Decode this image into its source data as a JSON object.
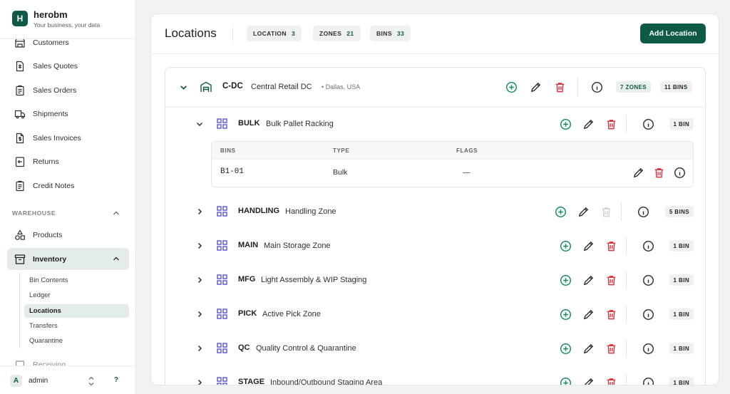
{
  "brand": {
    "logo_letter": "H",
    "name": "herobm",
    "tagline": "Your business, your data"
  },
  "sidebar": {
    "items": [
      {
        "label": "Customers",
        "icon": "storefront-icon"
      },
      {
        "label": "Sales Quotes",
        "icon": "quote-icon"
      },
      {
        "label": "Sales Orders",
        "icon": "clipboard-icon"
      },
      {
        "label": "Shipments",
        "icon": "truck-icon"
      },
      {
        "label": "Sales Invoices",
        "icon": "invoice-icon"
      },
      {
        "label": "Returns",
        "icon": "return-icon"
      },
      {
        "label": "Credit Notes",
        "icon": "credit-note-icon"
      }
    ],
    "section_label": "WAREHOUSE",
    "warehouse_items": [
      {
        "label": "Products",
        "icon": "shapes-icon"
      },
      {
        "label": "Inventory",
        "icon": "archive-icon"
      }
    ],
    "inventory_subitems": [
      "Bin Contents",
      "Ledger",
      "Locations",
      "Transfers",
      "Quarantine"
    ],
    "active_subitem": "Locations",
    "partial_item": "Receiving"
  },
  "user": {
    "avatar_letter": "A",
    "name": "admin",
    "help": "?"
  },
  "header": {
    "title": "Locations",
    "pills": [
      {
        "label": "LOCATION",
        "value": "3"
      },
      {
        "label": "ZONES",
        "value": "21"
      },
      {
        "label": "BINS",
        "value": "33"
      }
    ],
    "add_button": "Add Location"
  },
  "location": {
    "code": "C-DC",
    "name": "Central Retail DC",
    "place": "• Dallas, USA",
    "zones_badge": "7 ZONES",
    "bins_badge": "11 BINS"
  },
  "zones": [
    {
      "code": "BULK",
      "name": "Bulk Pallet Racking",
      "bins": "1 BIN",
      "expanded": true,
      "delete_disabled": false
    },
    {
      "code": "HANDLING",
      "name": "Handling Zone",
      "bins": "5 BINS",
      "expanded": false,
      "delete_disabled": true
    },
    {
      "code": "MAIN",
      "name": "Main Storage Zone",
      "bins": "1 BIN",
      "expanded": false,
      "delete_disabled": false
    },
    {
      "code": "MFG",
      "name": "Light Assembly & WIP Staging",
      "bins": "1 BIN",
      "expanded": false,
      "delete_disabled": false
    },
    {
      "code": "PICK",
      "name": "Active Pick Zone",
      "bins": "1 BIN",
      "expanded": false,
      "delete_disabled": false
    },
    {
      "code": "QC",
      "name": "Quality Control & Quarantine",
      "bins": "1 BIN",
      "expanded": false,
      "delete_disabled": false
    },
    {
      "code": "STAGE",
      "name": "Inbound/Outbound Staging Area",
      "bins": "1 BIN",
      "expanded": false,
      "delete_disabled": false
    }
  ],
  "bins_table": {
    "headers": [
      "BINS",
      "TYPE",
      "FLAGS"
    ],
    "rows": [
      {
        "bin": "B1-01",
        "type": "Bulk",
        "flags": "—"
      }
    ]
  },
  "colors": {
    "accent": "#0f5a46",
    "add": "#0f8a5c",
    "delete": "#d8343f",
    "delete_disabled": "#cfd3d1"
  }
}
